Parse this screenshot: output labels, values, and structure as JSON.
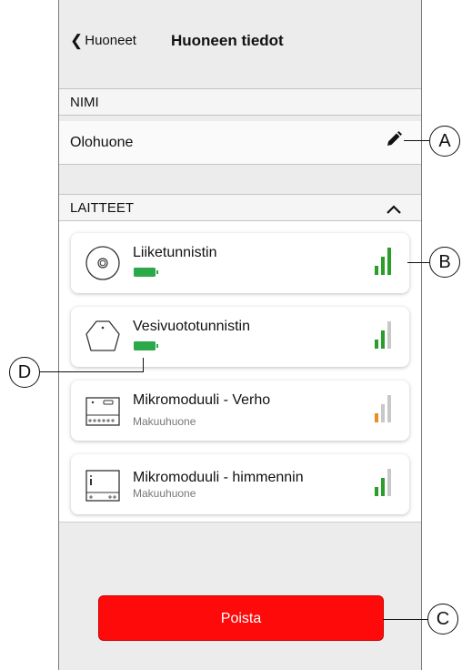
{
  "header": {
    "back_label": "Huoneet",
    "title": "Huoneen tiedot"
  },
  "name_section": {
    "label": "NIMI",
    "value": "Olohuone"
  },
  "devices_section": {
    "label": "LAITTEET"
  },
  "devices": [
    {
      "name": "Liiketunnistin",
      "location": "",
      "icon": "motion-sensor-icon",
      "battery": true,
      "signal_bars": 3,
      "signal_color": "#2a9d2a"
    },
    {
      "name": "Vesivuototunnistin",
      "location": "",
      "icon": "water-leak-sensor-icon",
      "battery": true,
      "signal_bars": 2,
      "signal_color": "#2a9d2a"
    },
    {
      "name": "Mikromoduuli - Verho",
      "location": "Makuuhuone",
      "icon": "micromodule-shutter-icon",
      "battery": false,
      "signal_bars": 1,
      "signal_color": "#f08c1e"
    },
    {
      "name": "Mikromoduuli - himmennin",
      "location": "Makuuhuone",
      "icon": "micromodule-dimmer-icon",
      "battery": false,
      "signal_bars": 2,
      "signal_color": "#2a9d2a"
    }
  ],
  "delete_button": {
    "label": "Poista"
  },
  "callouts": {
    "a": "A",
    "b": "B",
    "c": "C",
    "d": "D"
  },
  "colors": {
    "accent_red": "#ff0a0a",
    "signal_green": "#2a9d2a",
    "signal_orange": "#f08c1e",
    "signal_gray": "#c8c8c8",
    "battery_green": "#2aa84a"
  }
}
